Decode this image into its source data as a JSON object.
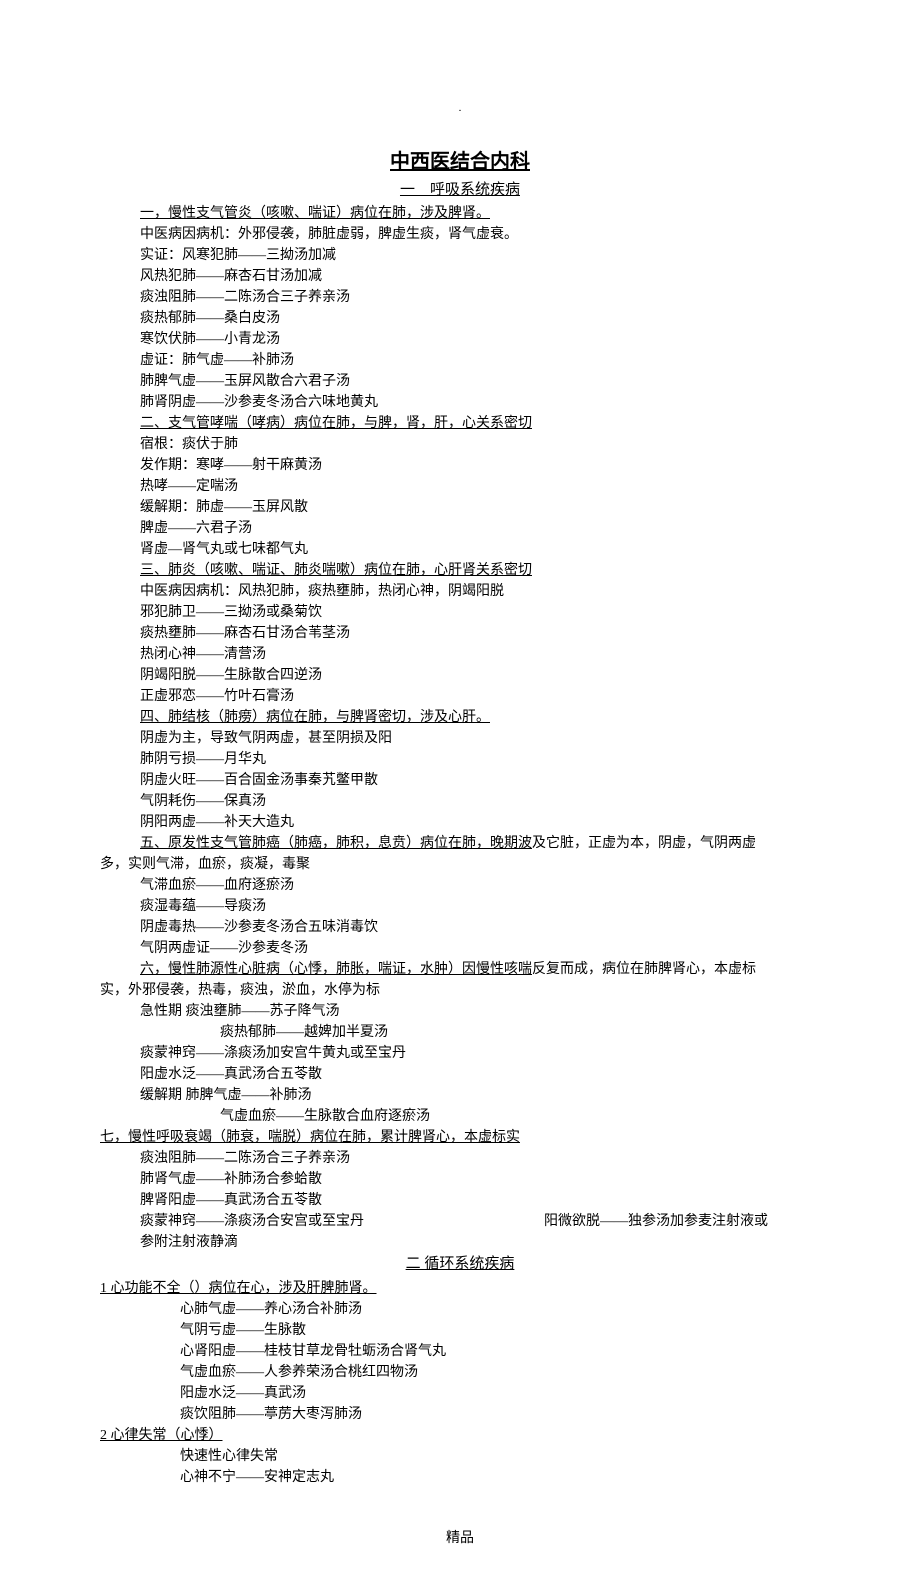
{
  "header_dot": ".",
  "main_title": "中西医结合内科",
  "s1": {
    "title": "一　呼吸系统疾病",
    "l1": "一，慢性支气管炎（咳嗽、喘证）病位在肺，涉及脾肾。",
    "l2": "中医病因病机：外邪侵袭，肺脏虚弱，脾虚生痰，肾气虚衰。",
    "l3": "实证：风寒犯肺——三拗汤加减",
    "l4": "风热犯肺——麻杏石甘汤加减",
    "l5": "痰浊阻肺——二陈汤合三子养亲汤",
    "l6": "痰热郁肺——桑白皮汤",
    "l7": "寒饮伏肺——小青龙汤",
    "l8": "虚证：肺气虚——补肺汤",
    "l9": "肺脾气虚——玉屏风散合六君子汤",
    "l10": "肺肾阴虚——沙参麦冬汤合六味地黄丸",
    "l11": "二、支气管哮喘（哮病）病位在肺，与脾，肾，肝，心关系密切",
    "l12": "宿根：痰伏于肺",
    "l13": "发作期：寒哮——射干麻黄汤",
    "l14": "热哮——定喘汤",
    "l15": "缓解期：肺虚——玉屏风散",
    "l16": "脾虚——六君子汤",
    "l17": "肾虚—肾气丸或七味都气丸",
    "l18": "三、肺炎（咳嗽、喘证、肺炎喘嗽）病位在肺，心肝肾关系密切",
    "l19": "中医病因病机：风热犯肺，痰热壅肺，热闭心神，阴竭阳脱",
    "l20": "邪犯肺卫——三拗汤或桑菊饮",
    "l21": "痰热壅肺——麻杏石甘汤合苇茎汤",
    "l22": "热闭心神——清营汤",
    "l23": "阴竭阳脱——生脉散合四逆汤",
    "l24": "正虚邪恋——竹叶石膏汤",
    "l25": "四、肺结核（肺痨）病位在肺，与脾肾密切，涉及心肝。",
    "l26": "阴虚为主，导致气阴两虚，甚至阴损及阳",
    "l27": "肺阴亏损——月华丸",
    "l28": "阴虚火旺——百合固金汤事秦艽鳖甲散",
    "l29": "气阴耗伤——保真汤",
    "l30": "阴阳两虚——补天大造丸",
    "l31a": "五、原发性支气管肺癌（肺癌，肺积，息贲）病位在肺，晚期波",
    "l31b": "及它脏，正虚为本，阴虚，气阴两虚",
    "l32": "多，实则气滞，血瘀，痰凝，毒聚",
    "l33": "气滞血瘀——血府逐瘀汤",
    "l34": "痰湿毒蕴——导痰汤",
    "l35": "阴虚毒热——沙参麦冬汤合五味消毒饮",
    "l36": "气阴两虚证——沙参麦冬汤",
    "l37a": "六，慢性肺源性心脏病（心悸，肺胀，喘证，水肿）因慢性咳喘",
    "l37b": "反复而成，病位在肺脾肾心，本虚标",
    "l38": "实，外邪侵袭，热毒，痰浊，淤血，水停为标",
    "l39": "急性期 痰浊壅肺——苏子降气汤",
    "l40": "痰热郁肺——越婢加半夏汤",
    "l41": "痰蒙神窍——涤痰汤加安宫牛黄丸或至宝丹",
    "l42": "阳虚水泛——真武汤合五苓散",
    "l43": "缓解期 肺脾气虚——补肺汤",
    "l44": "气虚血瘀——生脉散合血府逐瘀汤",
    "l45": "七，慢性呼吸衰竭（肺衰，喘脱）病位在肺，累计脾肾心，本虚标实",
    "l46": "痰浊阻肺——二陈汤合三子养亲汤",
    "l47": "肺肾气虚——补肺汤合参蛤散",
    "l48": "脾肾阳虚——真武汤合五苓散",
    "l49": "痰蒙神窍——涤痰汤合安宫或至宝丹",
    "l49r": "阳微欲脱——独参汤加参麦注射液或",
    "l50": "参附注射液静滴"
  },
  "s2": {
    "title": "二 循环系统疾病",
    "l1": "1 心功能不全（）病位在心，涉及肝脾肺肾。",
    "l2": "心肺气虚——养心汤合补肺汤",
    "l3": "气阴亏虚——生脉散",
    "l4": "心肾阳虚——桂枝甘草龙骨牡蛎汤合肾气丸",
    "l5": "气虚血瘀——人参养荣汤合桃红四物汤",
    "l6": "阳虚水泛——真武汤",
    "l7": "痰饮阻肺——葶苈大枣泻肺汤",
    "l8": "2 心律失常（心悸）",
    "l9": "快速性心律失常",
    "l10": "心神不宁——安神定志丸"
  },
  "footer": "精品"
}
